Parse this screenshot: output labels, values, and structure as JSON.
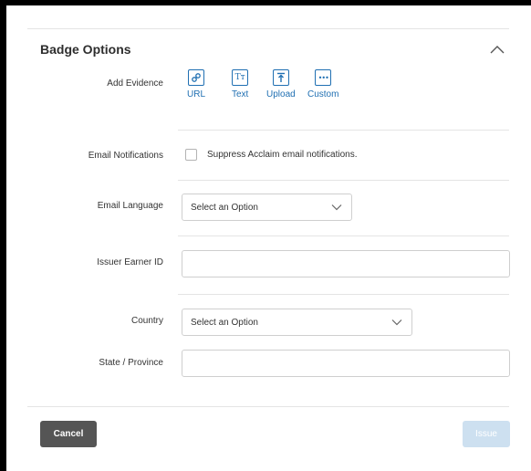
{
  "section": {
    "title": "Badge Options",
    "collapse_icon": "chevron-up-icon"
  },
  "evidence": {
    "label": "Add Evidence",
    "options": [
      {
        "label": "URL",
        "icon": "link-icon"
      },
      {
        "label": "Text",
        "icon": "text-icon",
        "glyph": "Tт"
      },
      {
        "label": "Upload",
        "icon": "upload-icon"
      },
      {
        "label": "Custom",
        "icon": "ellipsis-icon",
        "glyph": "•••"
      }
    ]
  },
  "notifications": {
    "label": "Email Notifications",
    "checkbox_label": "Suppress Acclaim email notifications.",
    "checked": false
  },
  "language": {
    "label": "Email Language",
    "selected": "Select an Option"
  },
  "earner_id": {
    "label": "Issuer Earner ID",
    "value": ""
  },
  "country": {
    "label": "Country",
    "selected": "Select an Option"
  },
  "state": {
    "label": "State / Province",
    "value": ""
  },
  "footer": {
    "cancel_label": "Cancel",
    "issue_label": "Issue"
  },
  "colors": {
    "accent": "#1f6fb2",
    "cancel_bg": "#555555",
    "issue_disabled_bg": "#cde0f0"
  }
}
